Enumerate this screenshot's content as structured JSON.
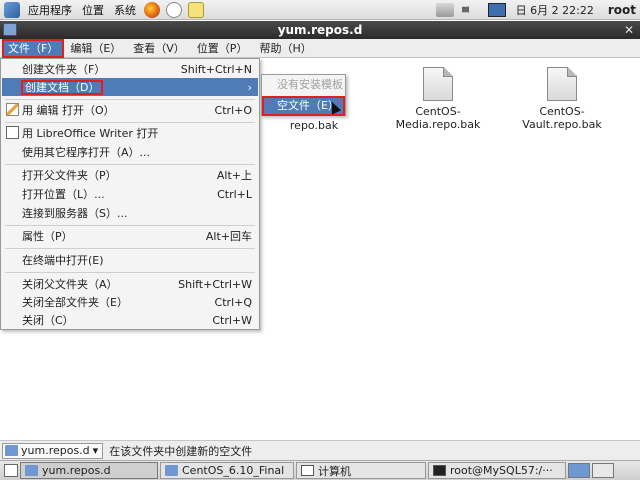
{
  "top_panel": {
    "applications": "应用程序",
    "places": "位置",
    "system": "系统",
    "clock": "日 6月  2 22:22",
    "user": "root"
  },
  "window": {
    "title": "yum.repos.d"
  },
  "menubar": {
    "file": "文件（F）",
    "edit": "编辑（E）",
    "view": "查看（V）",
    "places": "位置（P）",
    "help": "帮助（H）"
  },
  "file_menu": {
    "items": [
      {
        "label": "创建文件夹（F）",
        "accel": "Shift+Ctrl+N"
      },
      {
        "label": "创建文档（D）",
        "accel": "›"
      },
      {
        "label": "用 编辑 打开（O）",
        "accel": "Ctrl+O"
      },
      {
        "label": "用 LibreOffice Writer 打开",
        "accel": ""
      },
      {
        "label": "使用其它程序打开（A）...",
        "accel": ""
      },
      {
        "label": "打开父文件夹（P）",
        "accel": "Alt+上"
      },
      {
        "label": "打开位置（L）...",
        "accel": "Ctrl+L"
      },
      {
        "label": "连接到服务器（S）...",
        "accel": ""
      },
      {
        "label": "属性（P）",
        "accel": "Alt+回车"
      },
      {
        "label": "在终端中打开(E)",
        "accel": ""
      },
      {
        "label": "关闭父文件夹（A）",
        "accel": "Shift+Ctrl+W"
      },
      {
        "label": "关闭全部文件夹（E）",
        "accel": "Ctrl+Q"
      },
      {
        "label": "关闭（C）",
        "accel": "Ctrl+W"
      }
    ]
  },
  "submenu": {
    "no_templates": "没有安装模板",
    "empty_file": "空文件（E）"
  },
  "files": [
    {
      "name": "repo.bak"
    },
    {
      "name": "CentOS-Media.repo.bak"
    },
    {
      "name": "CentOS-Vault.repo.bak"
    }
  ],
  "statusbar": {
    "location": "yum.repos.d",
    "message": "在该文件夹中创建新的空文件"
  },
  "taskbar": {
    "tasks": [
      {
        "label": "yum.repos.d"
      },
      {
        "label": "CentOS_6.10_Final"
      },
      {
        "label": "计算机"
      },
      {
        "label": "root@MySQL57:/···"
      }
    ]
  }
}
